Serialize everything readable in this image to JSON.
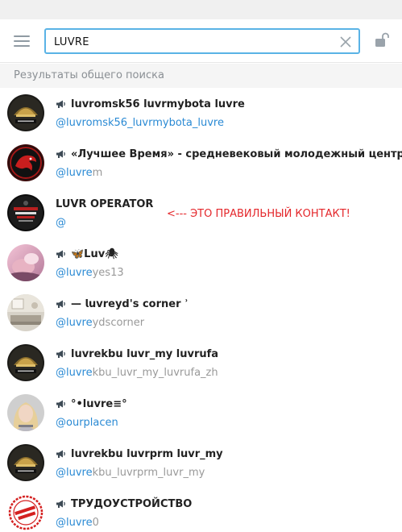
{
  "search": {
    "value": "LUVRE"
  },
  "section_header": "Результаты общего поиска",
  "annotation": "<--- ЭТО ПРАВИЛЬНЫЙ КОНТАКТ!",
  "colors": {
    "accent": "#5ab3e6",
    "link": "#2a8ad4",
    "annotation": "#e4272b"
  },
  "results": [
    {
      "title": "luvromsk56 luvrmybota luvre",
      "channel_icon": true,
      "username_hl": "@luvromsk56_luvrmybota_luvre",
      "username_rest": "",
      "avatar": "gold-crest"
    },
    {
      "title": "«Лучшее Время» - средневековый молодежный центр",
      "channel_icon": true,
      "username_hl": "@luvre",
      "username_rest": "m",
      "avatar": "red-dragon"
    },
    {
      "title": "LUVR OPERATOR",
      "channel_icon": false,
      "username_hl": "@",
      "username_rest": "",
      "avatar": "operator"
    },
    {
      "title": "🦋Luv🕷",
      "channel_icon": true,
      "username_hl": "@luvre",
      "username_rest": "yes13",
      "avatar": "pink-photo"
    },
    {
      "title": "— 𝗹𝘂𝘃𝗿𝗲𝘆𝗱'𝘀 𝗰𝗼𝗿𝗻𝗲𝗿 ʾ",
      "channel_icon": true,
      "username_hl": "@luvre",
      "username_rest": "ydscorner",
      "avatar": "room-photo"
    },
    {
      "title": "luvrekbu luvr_my luvrufa",
      "channel_icon": true,
      "username_hl": "@luvre",
      "username_rest": "kbu_luvr_my_luvrufa_zh",
      "avatar": "gold-crest"
    },
    {
      "title": "°•luvre≡°",
      "channel_icon": true,
      "username_hl": "@ourplacen",
      "username_rest": "",
      "avatar": "girl-photo"
    },
    {
      "title": "luvrekbu luvrprm luvr_my",
      "channel_icon": true,
      "username_hl": "@luvre",
      "username_rest": "kbu_luvrprm_luvr_my",
      "avatar": "gold-crest"
    },
    {
      "title": "ТРУДОУСТРОЙСТВО",
      "channel_icon": true,
      "username_hl": "@luvre",
      "username_rest": "0",
      "avatar": "stamp"
    }
  ]
}
